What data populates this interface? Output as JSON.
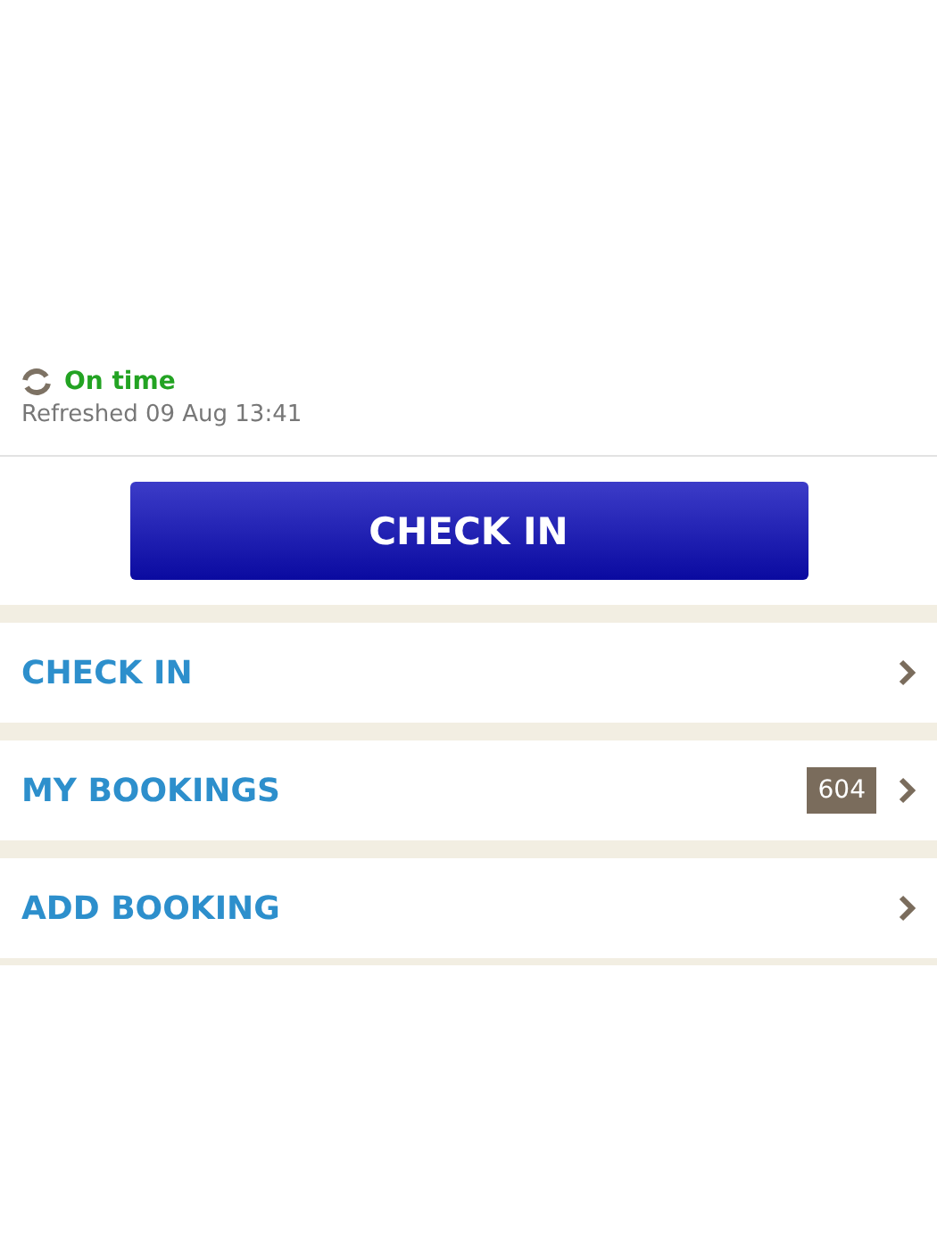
{
  "status": {
    "label": "On time",
    "refreshed": "Refreshed 09 Aug 13:41"
  },
  "primary_button": {
    "label": "CHECK IN"
  },
  "menu": [
    {
      "label": "CHECK IN"
    },
    {
      "label": "MY BOOKINGS",
      "badge": "604"
    },
    {
      "label": "ADD BOOKING"
    }
  ]
}
